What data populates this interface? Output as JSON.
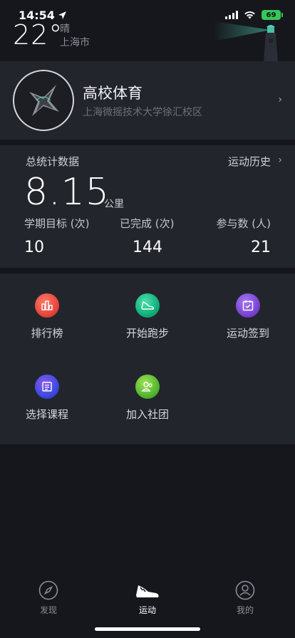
{
  "status_bar": {
    "time": "14:54",
    "battery": "69",
    "icons": [
      "location-arrow-icon",
      "signal-icon",
      "wifi-icon",
      "battery-icon"
    ]
  },
  "weather": {
    "temperature": "22°",
    "condition": "晴",
    "city": "上海市"
  },
  "school": {
    "name": "高校体育",
    "campus": "上海微摇技术大学徐汇校区"
  },
  "stats": {
    "title": "总统计数据",
    "history_link": "运动历史",
    "distance": "8.15",
    "distance_unit": "公里",
    "items": [
      {
        "label": "学期目标 (次)",
        "value": "10"
      },
      {
        "label": "已完成 (次)",
        "value": "144"
      },
      {
        "label": "参与数 (人)",
        "value": "21"
      }
    ]
  },
  "actions": [
    {
      "label": "排行榜",
      "icon": "ranking-icon",
      "color": "#e8473c"
    },
    {
      "label": "开始跑步",
      "icon": "sneaker-icon",
      "color": "#11b07a"
    },
    {
      "label": "运动签到",
      "icon": "calendar-check-icon",
      "color": "#7b44d6"
    },
    {
      "label": "选择课程",
      "icon": "course-list-icon",
      "color": "#3d49e0"
    },
    {
      "label": "加入社团",
      "icon": "club-people-icon",
      "color": "#55b830"
    }
  ],
  "tabs": [
    {
      "label": "发现",
      "icon": "compass-icon",
      "active": false
    },
    {
      "label": "运动",
      "icon": "sneaker-icon",
      "active": true
    },
    {
      "label": "我的",
      "icon": "profile-icon",
      "active": false
    }
  ],
  "colors": {
    "background": "#16171c",
    "card": "#23252d",
    "battery": "#35c759"
  }
}
